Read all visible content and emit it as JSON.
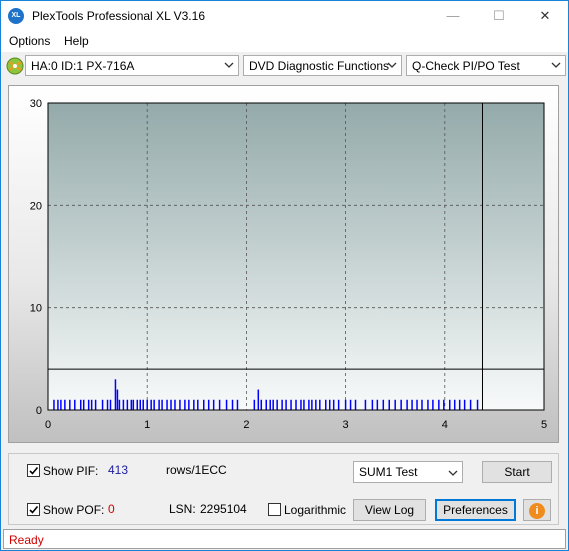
{
  "window": {
    "title": "PlexTools Professional XL V3.16",
    "app_icon_text": "XL",
    "minimize_glyph": "—",
    "maximize_glyph": "☐",
    "close_glyph": "✕"
  },
  "menu": {
    "items": [
      {
        "label": "Options"
      },
      {
        "label": "Help"
      }
    ]
  },
  "toolbar": {
    "drive": "HA:0 ID:1  PX-716A",
    "function": "DVD Diagnostic Functions",
    "test": "Q-Check PI/PO Test"
  },
  "chart_data": {
    "type": "bar",
    "xlim": [
      0,
      5
    ],
    "ylim": [
      0,
      30
    ],
    "x_ticks": [
      "0",
      "1",
      "2",
      "3",
      "4",
      "5"
    ],
    "y_ticks": [
      "0",
      "10",
      "20",
      "30"
    ],
    "grid": true,
    "threshold_y": 4,
    "end_marker_x": 4.38,
    "colors": {
      "bars": "#0000ff",
      "plot_top": "#94aaaa",
      "plot_bottom": "#f8fafa",
      "frame": "#000000"
    },
    "series": [
      {
        "values": [
          [
            0.06,
            1
          ],
          [
            0.1,
            1
          ],
          [
            0.13,
            1
          ],
          [
            0.17,
            1
          ],
          [
            0.22,
            1
          ],
          [
            0.27,
            1
          ],
          [
            0.33,
            1
          ],
          [
            0.36,
            1
          ],
          [
            0.41,
            1
          ],
          [
            0.44,
            1
          ],
          [
            0.48,
            1
          ],
          [
            0.55,
            1
          ],
          [
            0.6,
            1
          ],
          [
            0.63,
            1
          ],
          [
            0.68,
            3
          ],
          [
            0.7,
            2
          ],
          [
            0.72,
            1
          ],
          [
            0.76,
            1
          ],
          [
            0.8,
            1
          ],
          [
            0.84,
            1
          ],
          [
            0.86,
            1
          ],
          [
            0.9,
            1
          ],
          [
            0.93,
            1
          ],
          [
            0.96,
            1
          ],
          [
            1.0,
            1
          ],
          [
            1.04,
            1
          ],
          [
            1.07,
            1
          ],
          [
            1.12,
            1
          ],
          [
            1.15,
            1
          ],
          [
            1.2,
            1
          ],
          [
            1.24,
            1
          ],
          [
            1.28,
            1
          ],
          [
            1.33,
            1
          ],
          [
            1.38,
            1
          ],
          [
            1.42,
            1
          ],
          [
            1.47,
            1
          ],
          [
            1.51,
            1
          ],
          [
            1.57,
            1
          ],
          [
            1.62,
            1
          ],
          [
            1.67,
            1
          ],
          [
            1.73,
            1
          ],
          [
            1.8,
            1
          ],
          [
            1.86,
            1
          ],
          [
            1.91,
            1
          ],
          [
            2.08,
            1
          ],
          [
            2.12,
            2
          ],
          [
            2.15,
            1
          ],
          [
            2.2,
            1
          ],
          [
            2.24,
            1
          ],
          [
            2.27,
            1
          ],
          [
            2.31,
            1
          ],
          [
            2.36,
            1
          ],
          [
            2.4,
            1
          ],
          [
            2.45,
            1
          ],
          [
            2.5,
            1
          ],
          [
            2.55,
            1
          ],
          [
            2.58,
            1
          ],
          [
            2.63,
            1
          ],
          [
            2.66,
            1
          ],
          [
            2.7,
            1
          ],
          [
            2.74,
            1
          ],
          [
            2.8,
            1
          ],
          [
            2.84,
            1
          ],
          [
            2.88,
            1
          ],
          [
            2.93,
            1
          ],
          [
            3.0,
            1
          ],
          [
            3.05,
            1
          ],
          [
            3.1,
            1
          ],
          [
            3.2,
            1
          ],
          [
            3.27,
            1
          ],
          [
            3.32,
            1
          ],
          [
            3.38,
            1
          ],
          [
            3.44,
            1
          ],
          [
            3.5,
            1
          ],
          [
            3.56,
            1
          ],
          [
            3.62,
            1
          ],
          [
            3.67,
            1
          ],
          [
            3.72,
            1
          ],
          [
            3.77,
            1
          ],
          [
            3.83,
            1
          ],
          [
            3.88,
            1
          ],
          [
            3.94,
            1
          ],
          [
            3.99,
            1
          ],
          [
            4.05,
            1
          ],
          [
            4.1,
            1
          ],
          [
            4.15,
            1
          ],
          [
            4.2,
            1
          ],
          [
            4.26,
            1
          ],
          [
            4.33,
            1
          ]
        ]
      }
    ]
  },
  "controls": {
    "show_pif_label": "Show PIF:",
    "pif_value": "413",
    "rows_label": "rows/1ECC",
    "show_pof_label": "Show POF:",
    "pof_value": "0",
    "lsn_label": "LSN:",
    "lsn_value": "2295104",
    "logarithmic_label": "Logarithmic",
    "sum_select": "SUM1 Test",
    "start_button": "Start",
    "view_log_button": "View Log",
    "preferences_button": "Preferences",
    "info_icon_glyph": "i",
    "show_pif_checked": true,
    "show_pof_checked": true,
    "logarithmic_checked": false,
    "pif_value_color": "#1a1aa0",
    "pof_value_color": "#d00000"
  },
  "status": {
    "text": "Ready"
  }
}
